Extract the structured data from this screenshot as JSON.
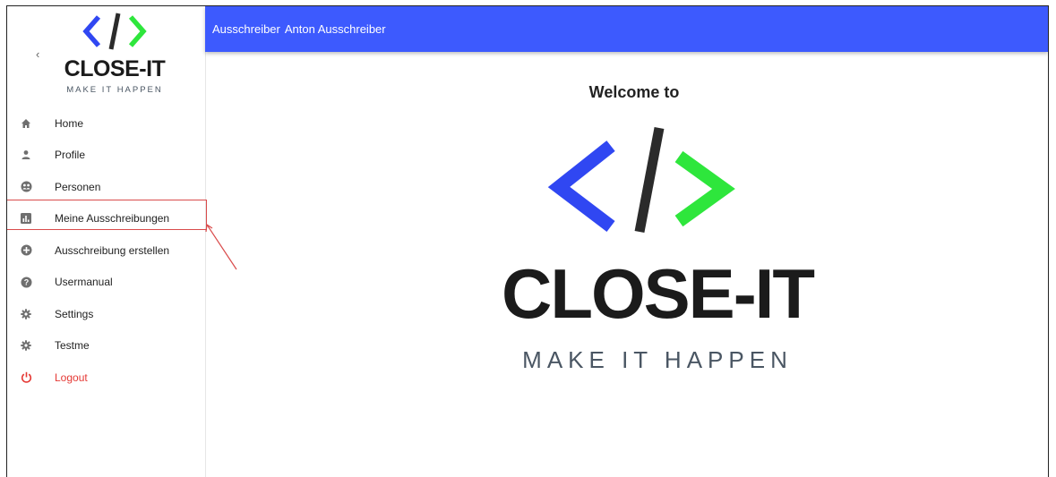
{
  "brand": {
    "name": "CLOSE-IT",
    "tagline": "MAKE IT HAPPEN",
    "colors": {
      "left_bracket": "#3047f2",
      "slash": "#2b2b2b",
      "right_bracket": "#2ee63c"
    }
  },
  "topbar": {
    "role": "Ausschreiber",
    "user_name": "Anton Ausschreiber",
    "color": "#3d5afe"
  },
  "sidebar": {
    "collapse_icon": "chevron-left-icon",
    "items": [
      {
        "label": "Home",
        "icon": "home-icon"
      },
      {
        "label": "Profile",
        "icon": "person-icon"
      },
      {
        "label": "Personen",
        "icon": "people-icon"
      },
      {
        "label": "Meine Ausschreibungen",
        "icon": "chart-icon",
        "highlighted": true
      },
      {
        "label": "Ausschreibung erstellen",
        "icon": "add-circle-icon"
      },
      {
        "label": "Usermanual",
        "icon": "help-icon"
      },
      {
        "label": "Settings",
        "icon": "gear-icon"
      },
      {
        "label": "Testme",
        "icon": "gear-icon"
      },
      {
        "label": "Logout",
        "icon": "power-icon",
        "color": "#e53935"
      }
    ]
  },
  "main": {
    "welcome": "Welcome to"
  }
}
